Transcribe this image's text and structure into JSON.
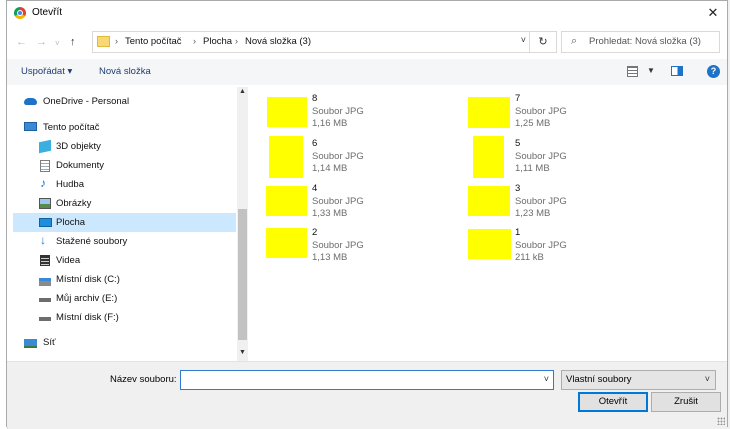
{
  "window": {
    "title": "Otevřít"
  },
  "nav": {
    "breadcrumbs": [
      "Tento počítač",
      "Plocha",
      "Nová složka (3)"
    ],
    "search_placeholder": "Prohledat: Nová složka (3)"
  },
  "toolbar": {
    "organize": "Uspořádat ▾",
    "new_folder": "Nová složka"
  },
  "sidebar": {
    "items": [
      {
        "label": "OneDrive - Personal",
        "icon": "cloud-icon"
      },
      {
        "label": "Tento počítač",
        "icon": "computer-icon"
      },
      {
        "label": "3D objekty",
        "icon": "cube-icon"
      },
      {
        "label": "Dokumenty",
        "icon": "document-icon"
      },
      {
        "label": "Hudba",
        "icon": "music-note-icon"
      },
      {
        "label": "Obrázky",
        "icon": "image-icon"
      },
      {
        "label": "Plocha",
        "icon": "desktop-icon",
        "selected": true
      },
      {
        "label": "Stažené soubory",
        "icon": "download-arrow-icon"
      },
      {
        "label": "Videa",
        "icon": "film-icon"
      },
      {
        "label": "Místní disk (C:)",
        "icon": "drive-windows-icon"
      },
      {
        "label": "Můj archiv (E:)",
        "icon": "drive-icon"
      },
      {
        "label": "Místní disk (F:)",
        "icon": "drive-icon"
      },
      {
        "label": "Síť",
        "icon": "network-icon"
      }
    ]
  },
  "files": [
    {
      "name": "8",
      "type": "Soubor JPG",
      "size": "1,16 MB"
    },
    {
      "name": "7",
      "type": "Soubor JPG",
      "size": "1,25 MB"
    },
    {
      "name": "6",
      "type": "Soubor JPG",
      "size": "1,14 MB"
    },
    {
      "name": "5",
      "type": "Soubor JPG",
      "size": "1,11 MB"
    },
    {
      "name": "4",
      "type": "Soubor JPG",
      "size": "1,33 MB"
    },
    {
      "name": "3",
      "type": "Soubor JPG",
      "size": "1,23 MB"
    },
    {
      "name": "2",
      "type": "Soubor JPG",
      "size": "1,13 MB"
    },
    {
      "name": "1",
      "type": "Soubor JPG",
      "size": "211 kB"
    }
  ],
  "footer": {
    "filename_label": "Název souboru:",
    "filename_value": "",
    "filetype": "Vlastní soubory",
    "open_label": "Otevřít",
    "cancel_label": "Zrušit"
  },
  "colors": {
    "accent": "#0078d7",
    "selection": "#cce8ff",
    "thumbnail": "#ffff00"
  }
}
